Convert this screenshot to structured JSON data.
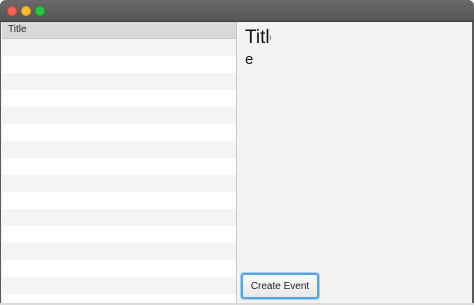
{
  "table": {
    "column_header": "Title"
  },
  "detail": {
    "title": "Title",
    "body": "e"
  },
  "actions": {
    "create_event_label": "Create Event"
  },
  "colors": {
    "focus_ring": "#54a4e0",
    "titlebar": "#5a5a5a",
    "pane_background": "#f3f3f3"
  }
}
